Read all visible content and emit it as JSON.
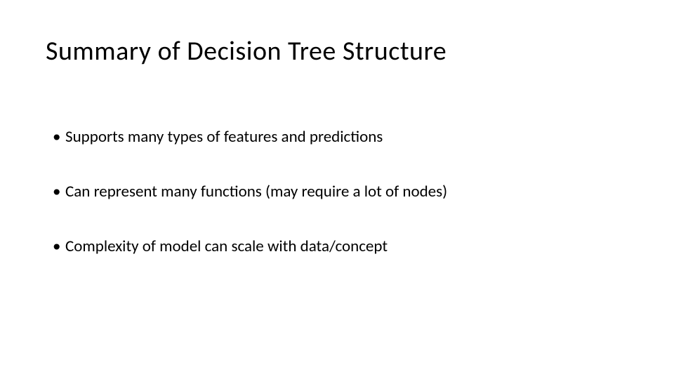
{
  "title": "Summary of Decision Tree Structure",
  "bullets": [
    "Supports many types of features and predictions",
    "Can represent many functions (may require a lot of nodes)",
    "Complexity of model can scale with data/concept"
  ]
}
